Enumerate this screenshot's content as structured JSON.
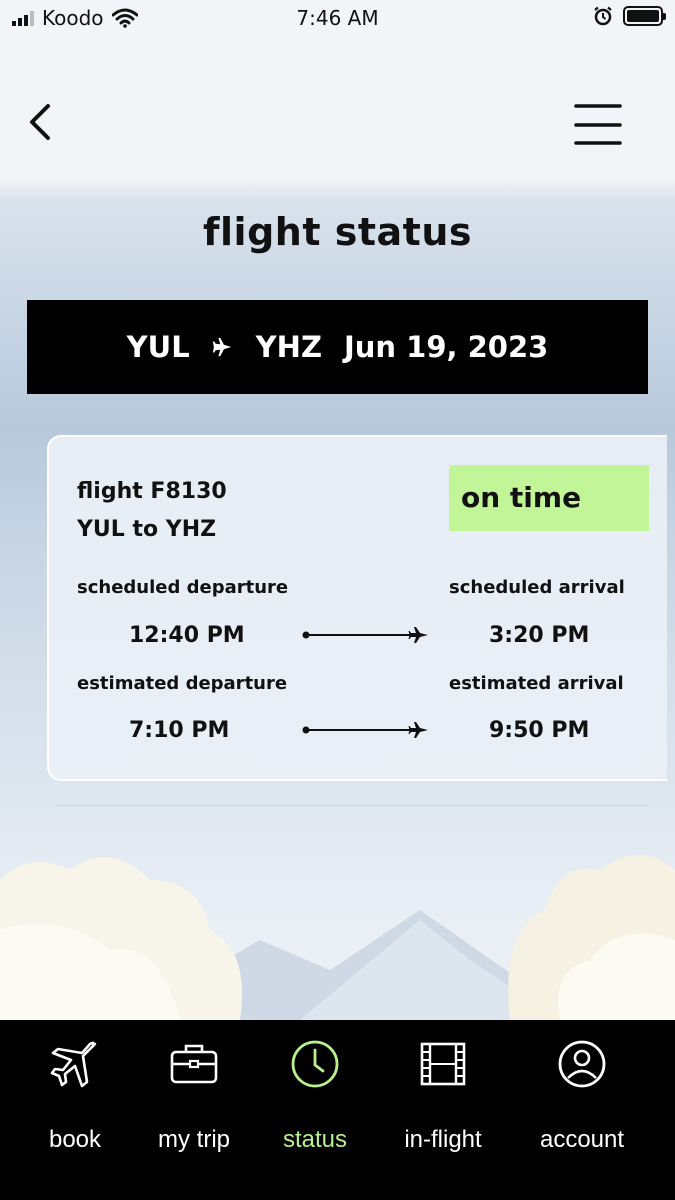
{
  "status_bar": {
    "carrier": "Koodo",
    "time": "7:46 AM"
  },
  "page": {
    "title": "flight status"
  },
  "route_bar": {
    "origin": "YUL",
    "destination": "YHZ",
    "date": "Jun 19, 2023"
  },
  "flight": {
    "number": "flight F8130",
    "route": "YUL to YHZ",
    "status": "on time",
    "status_color": "#c2f598",
    "scheduled_departure_label": "scheduled departure",
    "scheduled_arrival_label": "scheduled arrival",
    "scheduled_departure": "12:40 PM",
    "scheduled_arrival": "3:20 PM",
    "estimated_departure_label": "estimated departure",
    "estimated_arrival_label": "estimated arrival",
    "estimated_departure": "7:10 PM",
    "estimated_arrival": "9:50 PM"
  },
  "tabs": [
    {
      "label": "book",
      "icon": "airplane-icon",
      "active": false
    },
    {
      "label": "my trip",
      "icon": "briefcase-icon",
      "active": false
    },
    {
      "label": "status",
      "icon": "clock-icon",
      "active": true
    },
    {
      "label": "in-flight",
      "icon": "film-icon",
      "active": false
    },
    {
      "label": "account",
      "icon": "user-icon",
      "active": false
    }
  ],
  "colors": {
    "accent": "#b8f08c",
    "tabbar_bg": "#000000"
  }
}
